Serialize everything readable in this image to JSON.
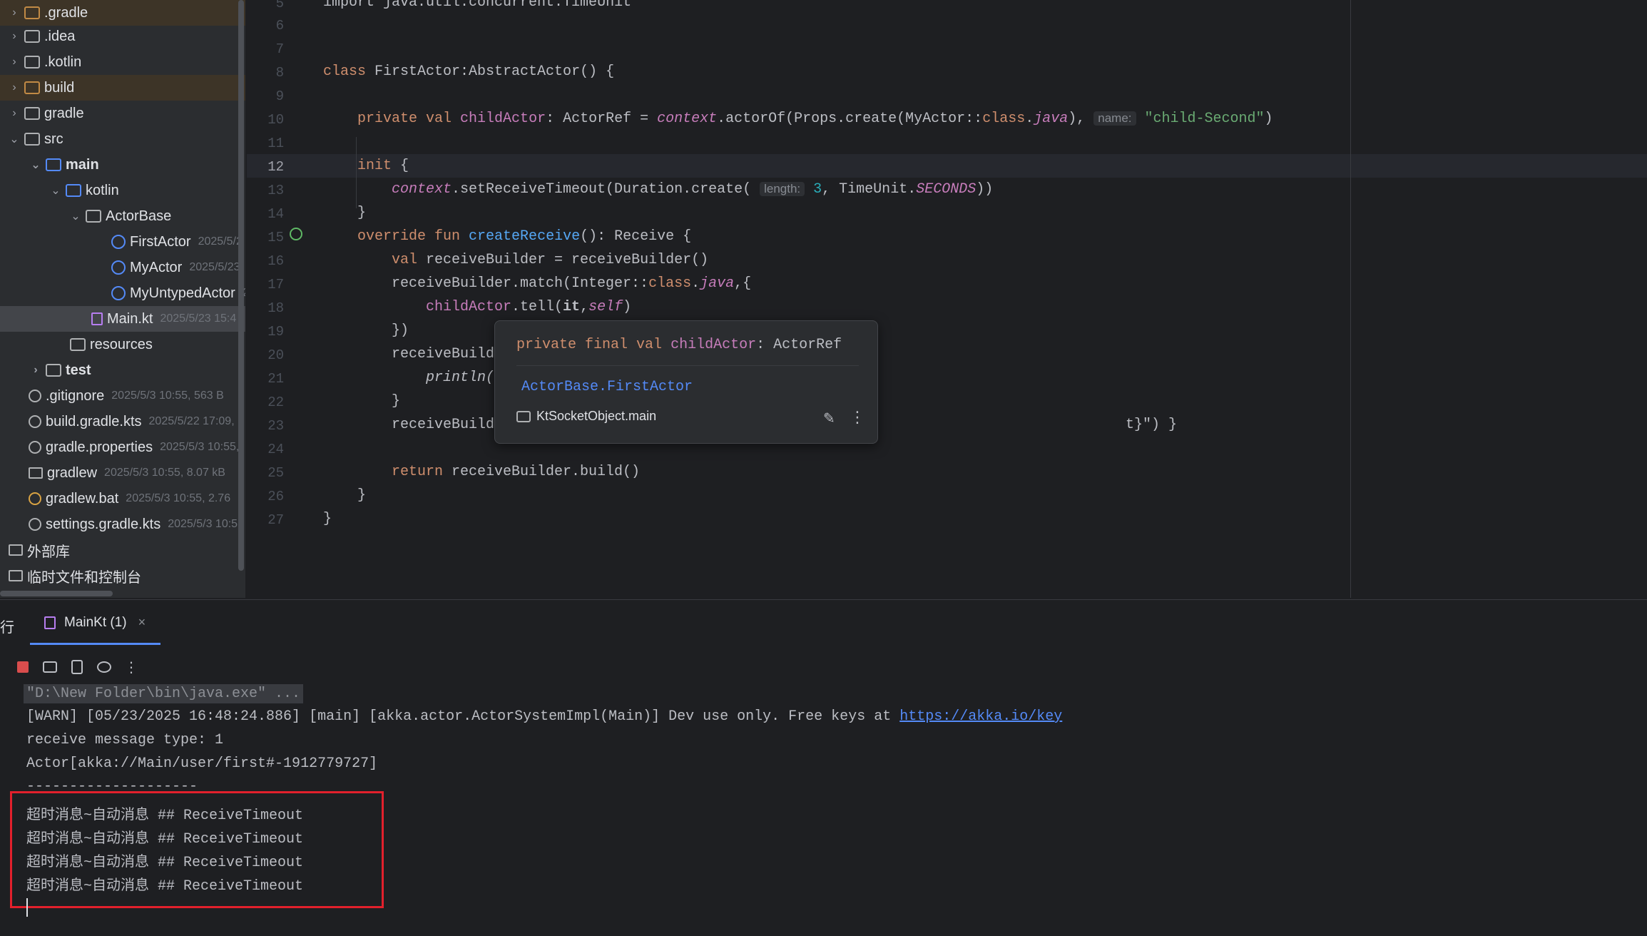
{
  "tree": {
    "items": [
      {
        "label": ".gradle",
        "meta": ""
      },
      {
        "label": ".idea",
        "meta": ""
      },
      {
        "label": ".kotlin",
        "meta": ""
      },
      {
        "label": "build",
        "meta": ""
      },
      {
        "label": "gradle",
        "meta": ""
      },
      {
        "label": "src",
        "meta": ""
      },
      {
        "label": "main",
        "meta": ""
      },
      {
        "label": "kotlin",
        "meta": ""
      },
      {
        "label": "ActorBase",
        "meta": ""
      },
      {
        "label": "FirstActor",
        "meta": "2025/5/2"
      },
      {
        "label": "MyActor",
        "meta": "2025/5/23"
      },
      {
        "label": "MyUntypedActor",
        "meta": "2"
      },
      {
        "label": "Main.kt",
        "meta": "2025/5/23 15:4"
      },
      {
        "label": "resources",
        "meta": ""
      },
      {
        "label": "test",
        "meta": ""
      },
      {
        "label": ".gitignore",
        "meta": "2025/5/3 10:55, 563 B"
      },
      {
        "label": "build.gradle.kts",
        "meta": "2025/5/22 17:09,"
      },
      {
        "label": "gradle.properties",
        "meta": "2025/5/3 10:55,"
      },
      {
        "label": "gradlew",
        "meta": "2025/5/3 10:55, 8.07 kB"
      },
      {
        "label": "gradlew.bat",
        "meta": "2025/5/3 10:55, 2.76"
      },
      {
        "label": "settings.gradle.kts",
        "meta": "2025/5/3 10:5"
      },
      {
        "label": "外部库",
        "meta": ""
      },
      {
        "label": "临时文件和控制台",
        "meta": ""
      }
    ]
  },
  "editor": {
    "line_numbers": [
      "5",
      "6",
      "7",
      "8",
      "9",
      "10",
      "11",
      "12",
      "13",
      "14",
      "15",
      "16",
      "17",
      "18",
      "19",
      "20",
      "21",
      "22",
      "23",
      "24",
      "25",
      "26",
      "27"
    ],
    "code": {
      "l5": "import java.util.concurrent.TimeUnit",
      "l8_kw": "class",
      "l8_rest": " FirstActor:AbstractActor() {",
      "l10_kw": "private val",
      "l10_prop": "childActor",
      "l10_a": ": ActorRef = ",
      "l10_ctx": "context",
      "l10_b": ".actorOf(Props.create(MyActor::",
      "l10_cls": "class",
      "l10_dot": ".",
      "l10_java": "java",
      "l10_c": "), ",
      "l10_hint": "name:",
      "l10_str": "\"child-Second\"",
      "l10_d": ")",
      "l12_kw": "init",
      "l12_b": " {",
      "l13_ctx": "context",
      "l13_a": ".setReceiveTimeout(Duration.create( ",
      "l13_hint": "length:",
      "l13_num": "3",
      "l13_b": ", TimeUnit.",
      "l13_static": "SECONDS",
      "l13_c": "))",
      "l14": "}",
      "l15_kw": "override fun",
      "l15_fn": "createReceive",
      "l15_rest": "(): Receive {",
      "l16_kw": "val",
      "l16_rest": " receiveBuilder = receiveBuilder()",
      "l17_a": "receiveBuilder.match(Integer::",
      "l17_cls": "class",
      "l17_dot": ".",
      "l17_java": "java",
      "l17_b": ",{",
      "l18_prop": "childActor",
      "l18_a": ".tell(",
      "l18_it": "it",
      "l18_comma": ",",
      "l18_self": "self",
      "l18_b": ")",
      "l19": "})",
      "l20": "receiveBuild",
      "l21": "println(",
      "l22": "}",
      "l23_a": "receiveBuild",
      "l23_b": "t}\") }",
      "l25_kw": "return",
      "l25_rest": " receiveBuilder.build()",
      "l26": "}",
      "l27": "}"
    }
  },
  "popup": {
    "sig_kw": "private final val",
    "sig_prop": "childActor",
    "sig_rest": ": ActorRef",
    "link": "ActorBase.FirstActor",
    "module": "KtSocketObject.main"
  },
  "run": {
    "panel_label": "行",
    "tab_label": "MainKt (1)",
    "tab_close": "×",
    "console": {
      "cmd": "\"D:\\New Folder\\bin\\java.exe\" ...",
      "warn_text": "[WARN] [05/23/2025 16:48:24.886] [main] [akka.actor.ActorSystemImpl(Main)] Dev use only. Free keys at ",
      "warn_link": "https://akka.io/key",
      "l3": "receive message type: 1",
      "l4": "Actor[akka://Main/user/first#-1912779727]",
      "l5": "--------------------",
      "timeouts": [
        "超时消息~自动消息 ## ReceiveTimeout",
        "超时消息~自动消息 ## ReceiveTimeout",
        "超时消息~自动消息 ## ReceiveTimeout",
        "超时消息~自动消息 ## ReceiveTimeout"
      ]
    }
  },
  "colors": {
    "accent": "#548af7",
    "highlight_box": "#e2202c",
    "stop": "#d94d4d"
  }
}
